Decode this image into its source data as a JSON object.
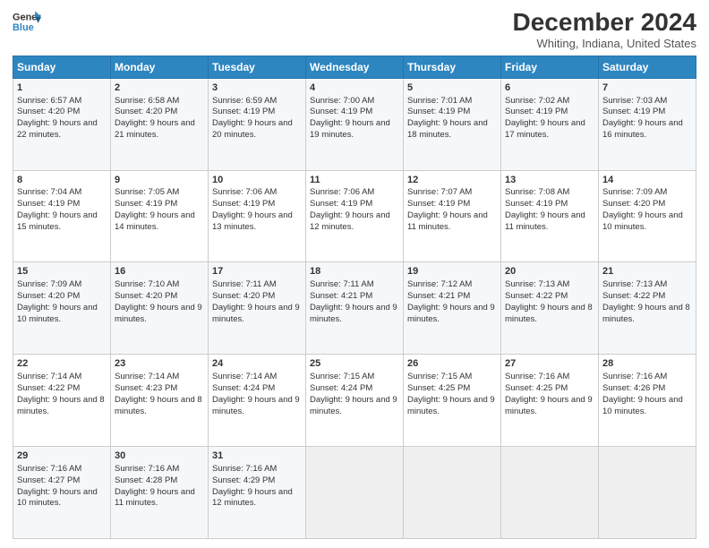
{
  "header": {
    "logo_line1": "General",
    "logo_line2": "Blue",
    "month_title": "December 2024",
    "location": "Whiting, Indiana, United States"
  },
  "weekdays": [
    "Sunday",
    "Monday",
    "Tuesday",
    "Wednesday",
    "Thursday",
    "Friday",
    "Saturday"
  ],
  "weeks": [
    [
      {
        "day": "1",
        "sunrise": "Sunrise: 6:57 AM",
        "sunset": "Sunset: 4:20 PM",
        "daylight": "Daylight: 9 hours and 22 minutes."
      },
      {
        "day": "2",
        "sunrise": "Sunrise: 6:58 AM",
        "sunset": "Sunset: 4:20 PM",
        "daylight": "Daylight: 9 hours and 21 minutes."
      },
      {
        "day": "3",
        "sunrise": "Sunrise: 6:59 AM",
        "sunset": "Sunset: 4:19 PM",
        "daylight": "Daylight: 9 hours and 20 minutes."
      },
      {
        "day": "4",
        "sunrise": "Sunrise: 7:00 AM",
        "sunset": "Sunset: 4:19 PM",
        "daylight": "Daylight: 9 hours and 19 minutes."
      },
      {
        "day": "5",
        "sunrise": "Sunrise: 7:01 AM",
        "sunset": "Sunset: 4:19 PM",
        "daylight": "Daylight: 9 hours and 18 minutes."
      },
      {
        "day": "6",
        "sunrise": "Sunrise: 7:02 AM",
        "sunset": "Sunset: 4:19 PM",
        "daylight": "Daylight: 9 hours and 17 minutes."
      },
      {
        "day": "7",
        "sunrise": "Sunrise: 7:03 AM",
        "sunset": "Sunset: 4:19 PM",
        "daylight": "Daylight: 9 hours and 16 minutes."
      }
    ],
    [
      {
        "day": "8",
        "sunrise": "Sunrise: 7:04 AM",
        "sunset": "Sunset: 4:19 PM",
        "daylight": "Daylight: 9 hours and 15 minutes."
      },
      {
        "day": "9",
        "sunrise": "Sunrise: 7:05 AM",
        "sunset": "Sunset: 4:19 PM",
        "daylight": "Daylight: 9 hours and 14 minutes."
      },
      {
        "day": "10",
        "sunrise": "Sunrise: 7:06 AM",
        "sunset": "Sunset: 4:19 PM",
        "daylight": "Daylight: 9 hours and 13 minutes."
      },
      {
        "day": "11",
        "sunrise": "Sunrise: 7:06 AM",
        "sunset": "Sunset: 4:19 PM",
        "daylight": "Daylight: 9 hours and 12 minutes."
      },
      {
        "day": "12",
        "sunrise": "Sunrise: 7:07 AM",
        "sunset": "Sunset: 4:19 PM",
        "daylight": "Daylight: 9 hours and 11 minutes."
      },
      {
        "day": "13",
        "sunrise": "Sunrise: 7:08 AM",
        "sunset": "Sunset: 4:19 PM",
        "daylight": "Daylight: 9 hours and 11 minutes."
      },
      {
        "day": "14",
        "sunrise": "Sunrise: 7:09 AM",
        "sunset": "Sunset: 4:20 PM",
        "daylight": "Daylight: 9 hours and 10 minutes."
      }
    ],
    [
      {
        "day": "15",
        "sunrise": "Sunrise: 7:09 AM",
        "sunset": "Sunset: 4:20 PM",
        "daylight": "Daylight: 9 hours and 10 minutes."
      },
      {
        "day": "16",
        "sunrise": "Sunrise: 7:10 AM",
        "sunset": "Sunset: 4:20 PM",
        "daylight": "Daylight: 9 hours and 9 minutes."
      },
      {
        "day": "17",
        "sunrise": "Sunrise: 7:11 AM",
        "sunset": "Sunset: 4:20 PM",
        "daylight": "Daylight: 9 hours and 9 minutes."
      },
      {
        "day": "18",
        "sunrise": "Sunrise: 7:11 AM",
        "sunset": "Sunset: 4:21 PM",
        "daylight": "Daylight: 9 hours and 9 minutes."
      },
      {
        "day": "19",
        "sunrise": "Sunrise: 7:12 AM",
        "sunset": "Sunset: 4:21 PM",
        "daylight": "Daylight: 9 hours and 9 minutes."
      },
      {
        "day": "20",
        "sunrise": "Sunrise: 7:13 AM",
        "sunset": "Sunset: 4:22 PM",
        "daylight": "Daylight: 9 hours and 8 minutes."
      },
      {
        "day": "21",
        "sunrise": "Sunrise: 7:13 AM",
        "sunset": "Sunset: 4:22 PM",
        "daylight": "Daylight: 9 hours and 8 minutes."
      }
    ],
    [
      {
        "day": "22",
        "sunrise": "Sunrise: 7:14 AM",
        "sunset": "Sunset: 4:22 PM",
        "daylight": "Daylight: 9 hours and 8 minutes."
      },
      {
        "day": "23",
        "sunrise": "Sunrise: 7:14 AM",
        "sunset": "Sunset: 4:23 PM",
        "daylight": "Daylight: 9 hours and 8 minutes."
      },
      {
        "day": "24",
        "sunrise": "Sunrise: 7:14 AM",
        "sunset": "Sunset: 4:24 PM",
        "daylight": "Daylight: 9 hours and 9 minutes."
      },
      {
        "day": "25",
        "sunrise": "Sunrise: 7:15 AM",
        "sunset": "Sunset: 4:24 PM",
        "daylight": "Daylight: 9 hours and 9 minutes."
      },
      {
        "day": "26",
        "sunrise": "Sunrise: 7:15 AM",
        "sunset": "Sunset: 4:25 PM",
        "daylight": "Daylight: 9 hours and 9 minutes."
      },
      {
        "day": "27",
        "sunrise": "Sunrise: 7:16 AM",
        "sunset": "Sunset: 4:25 PM",
        "daylight": "Daylight: 9 hours and 9 minutes."
      },
      {
        "day": "28",
        "sunrise": "Sunrise: 7:16 AM",
        "sunset": "Sunset: 4:26 PM",
        "daylight": "Daylight: 9 hours and 10 minutes."
      }
    ],
    [
      {
        "day": "29",
        "sunrise": "Sunrise: 7:16 AM",
        "sunset": "Sunset: 4:27 PM",
        "daylight": "Daylight: 9 hours and 10 minutes."
      },
      {
        "day": "30",
        "sunrise": "Sunrise: 7:16 AM",
        "sunset": "Sunset: 4:28 PM",
        "daylight": "Daylight: 9 hours and 11 minutes."
      },
      {
        "day": "31",
        "sunrise": "Sunrise: 7:16 AM",
        "sunset": "Sunset: 4:29 PM",
        "daylight": "Daylight: 9 hours and 12 minutes."
      },
      null,
      null,
      null,
      null
    ]
  ]
}
